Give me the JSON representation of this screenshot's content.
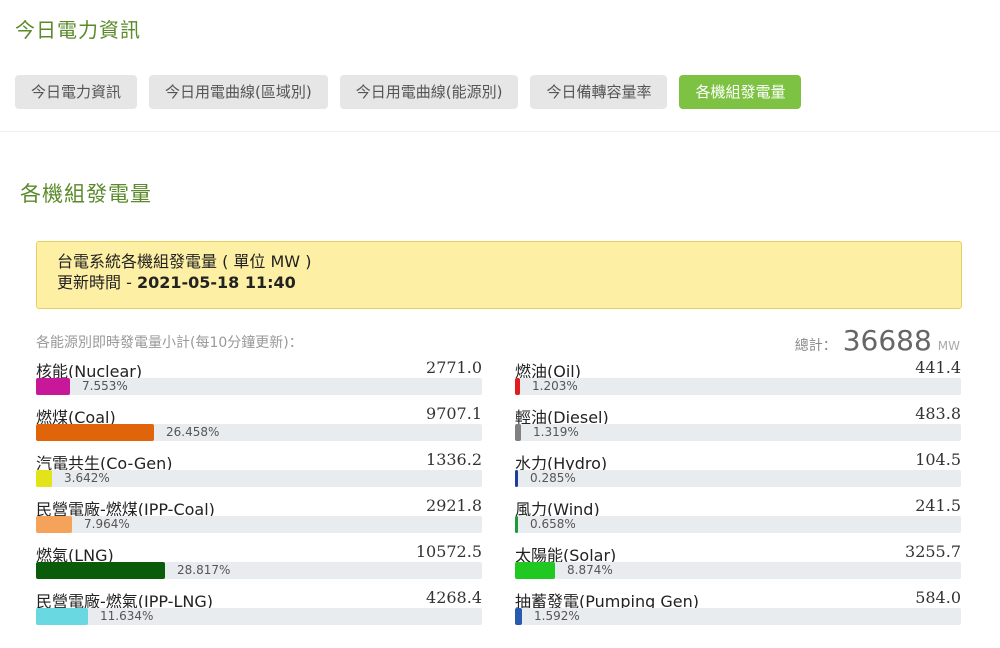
{
  "page": {
    "header_title": "今日電力資訊",
    "tabs": [
      {
        "label": "今日電力資訊",
        "active": false
      },
      {
        "label": "今日用電曲線(區域別)",
        "active": false
      },
      {
        "label": "今日用電曲線(能源別)",
        "active": false
      },
      {
        "label": "今日備轉容量率",
        "active": false
      },
      {
        "label": "各機組發電量",
        "active": true
      }
    ],
    "section_title": "各機組發電量"
  },
  "info": {
    "line1": "台電系統各機組發電量 ( 單位 MW )",
    "update_prefix": "更新時間 - ",
    "update_time": "2021-05-18 11:40"
  },
  "subtitle": "各能源別即時發電量小計(每10分鐘更新)：",
  "total": {
    "label": "總計：",
    "value": "36688",
    "unit": "MW"
  },
  "sources_left": [
    {
      "name": "核能(Nuclear)",
      "value": "2771.0",
      "percent_label": "7.553%",
      "percent": 7.553,
      "color": "#c8189a"
    },
    {
      "name": "燃煤(Coal)",
      "value": "9707.1",
      "percent_label": "26.458%",
      "percent": 26.458,
      "color": "#e0640a"
    },
    {
      "name": "汽電共生(Co-Gen)",
      "value": "1336.2",
      "percent_label": "3.642%",
      "percent": 3.642,
      "color": "#e3e31a"
    },
    {
      "name": "民營電廠-燃煤(IPP-Coal)",
      "value": "2921.8",
      "percent_label": "7.964%",
      "percent": 7.964,
      "color": "#f5a35a"
    },
    {
      "name": "燃氣(LNG)",
      "value": "10572.5",
      "percent_label": "28.817%",
      "percent": 28.817,
      "color": "#0a5c0a"
    },
    {
      "name": "民營電廠-燃氣(IPP-LNG)",
      "value": "4268.4",
      "percent_label": "11.634%",
      "percent": 11.634,
      "color": "#6ad8e0"
    }
  ],
  "sources_right": [
    {
      "name": "燃油(Oil)",
      "value": "441.4",
      "percent_label": "1.203%",
      "percent": 1.203,
      "color": "#e01e1e"
    },
    {
      "name": "輕油(Diesel)",
      "value": "483.8",
      "percent_label": "1.319%",
      "percent": 1.319,
      "color": "#808080"
    },
    {
      "name": "水力(Hydro)",
      "value": "104.5",
      "percent_label": "0.285%",
      "percent": 0.285,
      "color": "#1e3ca0"
    },
    {
      "name": "風力(Wind)",
      "value": "241.5",
      "percent_label": "0.658%",
      "percent": 0.658,
      "color": "#1a9a3a"
    },
    {
      "name": "太陽能(Solar)",
      "value": "3255.7",
      "percent_label": "8.874%",
      "percent": 8.874,
      "color": "#22c822"
    },
    {
      "name": "抽蓄發電(Pumping Gen)",
      "value": "584.0",
      "percent_label": "1.592%",
      "percent": 1.592,
      "color": "#2a5ab0"
    }
  ]
}
